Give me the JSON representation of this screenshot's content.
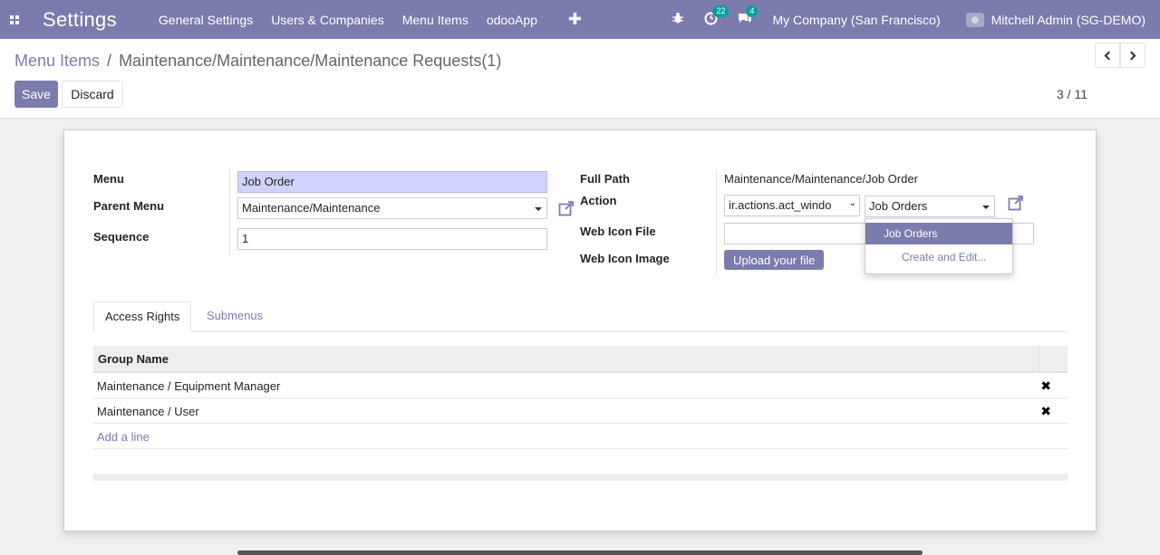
{
  "navbar": {
    "app_title": "Settings",
    "menu": [
      "General Settings",
      "Users & Companies",
      "Menu Items",
      "odooApp"
    ],
    "activity_count": "22",
    "messages_count": "4",
    "company": "My Company (San Francisco)",
    "user": "Mitchell Admin (SG-DEMO)"
  },
  "breadcrumb": {
    "parent": "Menu Items",
    "separator": "/",
    "current": "Maintenance/Maintenance/Maintenance Requests(1)"
  },
  "toolbar": {
    "save_label": "Save",
    "discard_label": "Discard",
    "pager": "3 / 11"
  },
  "form": {
    "menu_label": "Menu",
    "menu_value": "Job Order",
    "parent_menu_label": "Parent Menu",
    "parent_menu_value": "Maintenance/Maintenance",
    "sequence_label": "Sequence",
    "sequence_value": "1",
    "full_path_label": "Full Path",
    "full_path_value": "Maintenance/Maintenance/Job Order",
    "action_label": "Action",
    "action_type_value": "ir.actions.act_windo",
    "action_value": "Job Orders",
    "web_icon_file_label": "Web Icon File",
    "web_icon_image_label": "Web Icon Image",
    "upload_label": "Upload your file"
  },
  "dropdown": {
    "items": [
      "Job Orders",
      "Create and Edit..."
    ]
  },
  "tabs": [
    "Access Rights",
    "Submenus"
  ],
  "table": {
    "header": "Group Name",
    "rows": [
      "Maintenance / Equipment Manager",
      "Maintenance / User"
    ],
    "add_line": "Add a line"
  },
  "icons": {
    "apps": "apps-grid-icon",
    "debug": "bug-icon",
    "activity": "clock-icon",
    "messages": "chat-icon",
    "external": "external-link-icon",
    "delete": "times-icon"
  },
  "colors": {
    "primary": "#7c7bad",
    "required_bg": "#d2d2ff",
    "badge": "#00a09d"
  }
}
